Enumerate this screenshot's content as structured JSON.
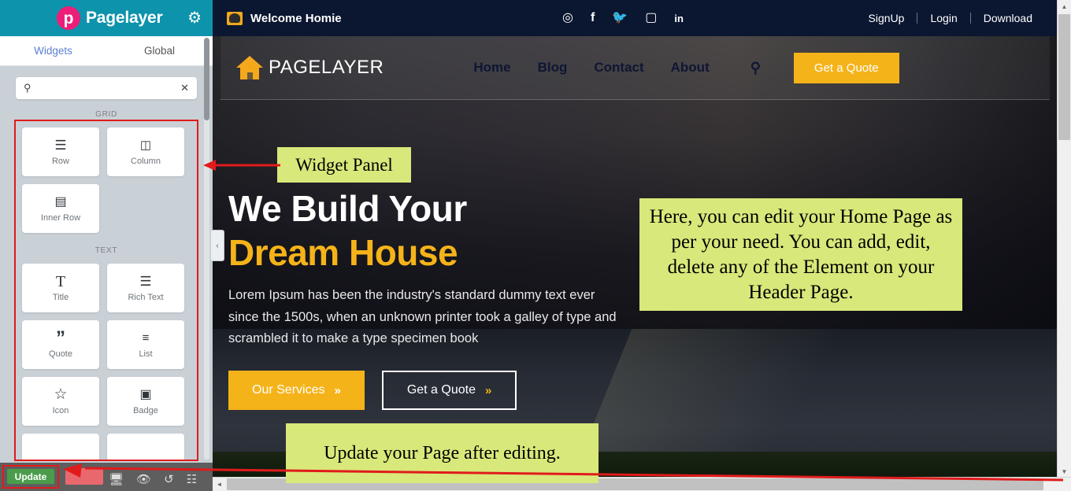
{
  "sidebar": {
    "brand": "Pagelayer",
    "gear_icon": "gear-icon",
    "tabs": [
      {
        "label": "Widgets",
        "active": true
      },
      {
        "label": "Global",
        "active": false
      }
    ],
    "search": {
      "value": "",
      "placeholder": "",
      "icon": "search-icon",
      "clear_icon": "close-icon"
    },
    "groups": [
      {
        "title": "GRID",
        "widgets": [
          {
            "label": "Row",
            "icon": "rows-icon",
            "glyph": "☰"
          },
          {
            "label": "Column",
            "icon": "columns-icon",
            "glyph": "▣"
          },
          {
            "label": "Inner Row",
            "icon": "table-icon",
            "glyph": "⊞"
          }
        ]
      },
      {
        "title": "TEXT",
        "widgets": [
          {
            "label": "Title",
            "icon": "title-icon",
            "glyph": "T"
          },
          {
            "label": "Rich Text",
            "icon": "rich-text-icon",
            "glyph": "≡"
          },
          {
            "label": "Quote",
            "icon": "quote-icon",
            "glyph": "”"
          },
          {
            "label": "List",
            "icon": "list-icon",
            "glyph": "☰"
          },
          {
            "label": "Icon",
            "icon": "star-icon",
            "glyph": "☆"
          },
          {
            "label": "Badge",
            "icon": "badge-icon",
            "glyph": "▣"
          }
        ]
      }
    ],
    "bottom_toolbar": {
      "update_label": "Update",
      "update_color": "#4a9c4a",
      "responsive_icon": "desktop-icon",
      "preview_icon": "eye-icon",
      "history_icon": "history-icon",
      "structure_icon": "sitemap-icon"
    }
  },
  "topnav": {
    "welcome": "Welcome Homie",
    "mail_icon": "envelope-icon",
    "social": [
      {
        "name": "dribbble-icon",
        "glyph": "⊕"
      },
      {
        "name": "facebook-icon",
        "glyph": "f"
      },
      {
        "name": "twitter-icon",
        "glyph": "ᵗ"
      },
      {
        "name": "instagram-icon",
        "glyph": "▢"
      },
      {
        "name": "linkedin-icon",
        "glyph": "in"
      }
    ],
    "links": [
      "SignUp",
      "Login",
      "Download"
    ]
  },
  "site_header": {
    "logo_icon": "home-icon",
    "logo_text": "PAGELAYER",
    "nav": [
      "Home",
      "Blog",
      "Contact",
      "About"
    ],
    "search_icon": "search-icon",
    "cta": "Get a Quote",
    "cta_color": "#f5b31a"
  },
  "hero": {
    "heading_line1": "We Build Your",
    "heading_line2": "Dream House",
    "heading_accent_color": "#f5b31a",
    "paragraph": "Lorem Ipsum has been the industry's standard dummy text ever since the 1500s, when an unknown printer took a galley of type and scrambled it to make a type specimen book",
    "primary_button": "Our Services",
    "secondary_button": "Get a Quote",
    "button_arrow": "»"
  },
  "annotations": {
    "widget_panel": "Widget Panel",
    "edit_home": "Here, you can edit your Home Page as per your need. You can add, edit, delete any of the Element on your Header Page.",
    "update_page": "Update your Page after editing.",
    "highlight_color": "#e01b1b",
    "note_color": "#d9e87a"
  },
  "scrollbars": {
    "up_glyph": "▲",
    "down_glyph": "▼",
    "left_glyph": "◄",
    "right_glyph": "►"
  },
  "collapse_handle": {
    "glyph": "‹"
  }
}
